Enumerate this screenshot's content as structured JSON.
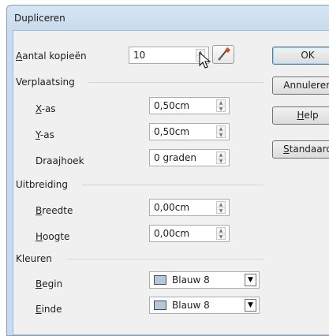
{
  "window": {
    "title": "Dupliceren"
  },
  "copies": {
    "label_u": "A",
    "label_rest": "antal kopieën",
    "value": "10"
  },
  "placement": {
    "section": "Verplaatsing",
    "x_label_u": "X",
    "x_label_rest": "-as",
    "x_value": "0,50cm",
    "y_label_u": "Y",
    "y_label_rest": "-as",
    "y_value": "0,50cm",
    "angle_label_pre": "Draa",
    "angle_label_u": "j",
    "angle_label_post": "hoek",
    "angle_value": "0 graden"
  },
  "enlargement": {
    "section": "Uitbreiding",
    "width_label_u": "B",
    "width_label_rest": "reedte",
    "width_value": "0,00cm",
    "height_label_u": "H",
    "height_label_rest": "oogte",
    "height_value": "0,00cm"
  },
  "colors": {
    "section": "Kleuren",
    "begin_label_u": "B",
    "begin_label_rest": "egin",
    "begin_value": "Blauw 8",
    "end_label_u": "E",
    "end_label_rest": "inde",
    "end_value": "Blauw 8",
    "swatch_color": "#b4c7dc"
  },
  "buttons": {
    "ok": "OK",
    "cancel": "Annuleren",
    "help_pre": "",
    "help_u": "H",
    "help_post": "elp",
    "defaults_u": "S",
    "defaults_rest": "tandaard"
  },
  "icons": {
    "pipette": "pipette-icon",
    "cursor": "mouse-cursor-icon"
  }
}
